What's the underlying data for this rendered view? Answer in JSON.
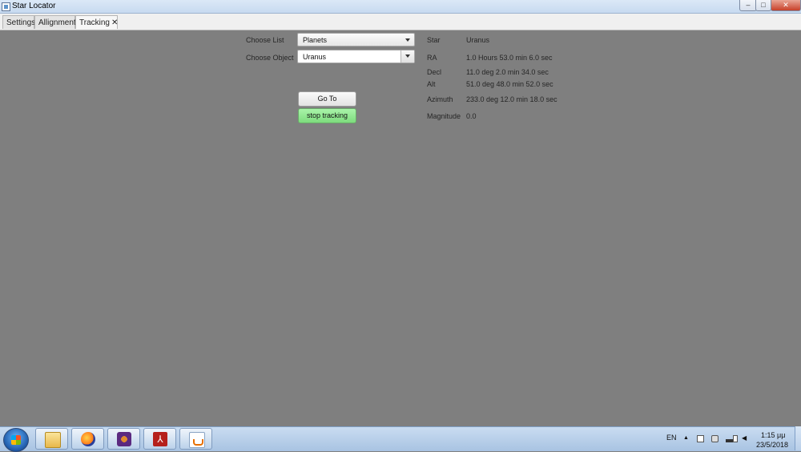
{
  "window": {
    "title": "Star Locator",
    "controls": {
      "minimize": "–",
      "maximize": "□",
      "close": "✕"
    }
  },
  "tabs": [
    {
      "label": "Settings"
    },
    {
      "label": "Allignment"
    },
    {
      "label": "Tracking",
      "close": "✕",
      "active": true
    }
  ],
  "form": {
    "choose_list_label": "Choose List",
    "choose_list_value": "Planets",
    "choose_object_label": "Choose Object",
    "choose_object_value": "Uranus",
    "goto_label": "Go To",
    "stop_label": "stop tracking"
  },
  "info": {
    "star_label": "Star",
    "star_value": "Uranus",
    "ra_label": "RA",
    "ra_value": "1.0 Hours 53.0 min 6.0 sec",
    "decl_label": "Decl",
    "decl_value": "11.0 deg 2.0 min 34.0 sec",
    "alt_label": "Alt",
    "alt_value": "51.0 deg 48.0 min 52.0 sec",
    "azimuth_label": "Azimuth",
    "azimuth_value": "233.0 deg 12.0 min 18.0 sec",
    "magnitude_label": "Magnitude",
    "magnitude_value": "0.0"
  },
  "taskbar": {
    "pdf_glyph": "⅄",
    "language": "EN",
    "tray_up": "▲",
    "volume": "◀",
    "time": "1:15 μμ",
    "date": "23/5/2018"
  },
  "colors": {
    "background": "#7f7f7f",
    "stop_button": "#8ee48e"
  }
}
